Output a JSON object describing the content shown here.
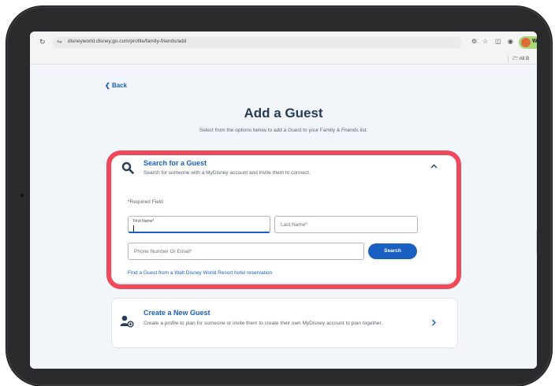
{
  "browser": {
    "reload_icon": "reload-icon",
    "site_icon": "site-settings-icon",
    "url": "disneyworld.disney.go.com/profile/family-friends/add",
    "profile_label": "Wo",
    "bookmarks_label": "All B"
  },
  "page": {
    "back_label": "Back",
    "title": "Add a Guest",
    "subtitle": "Select from the options below to add a Guest to your Family & Friends list."
  },
  "search_card": {
    "heading": "Search for a Guest",
    "description": "Search for someone with a MyDisney account and invite them to connect.",
    "required_note": "*Required Field",
    "first_name_label": "First Name*",
    "last_name_placeholder": "Last Name*",
    "phone_email_placeholder": "Phone Number Or Email*",
    "search_button": "Search",
    "resort_link": "Find a Guest from a Walt Disney World Resort hotel reservation"
  },
  "create_card": {
    "heading": "Create a New Guest",
    "description": "Create a profile to plan for someone or invite them to create their own MyDisney account to plan together."
  },
  "colors": {
    "accent": "#1a5fc2",
    "title": "#253b56",
    "highlight": "#ef4a5a"
  },
  "icons": [
    "reload-icon",
    "site-settings-icon",
    "magnifier-icon",
    "chevron-up-icon",
    "add-person-icon",
    "chevron-right-icon"
  ]
}
